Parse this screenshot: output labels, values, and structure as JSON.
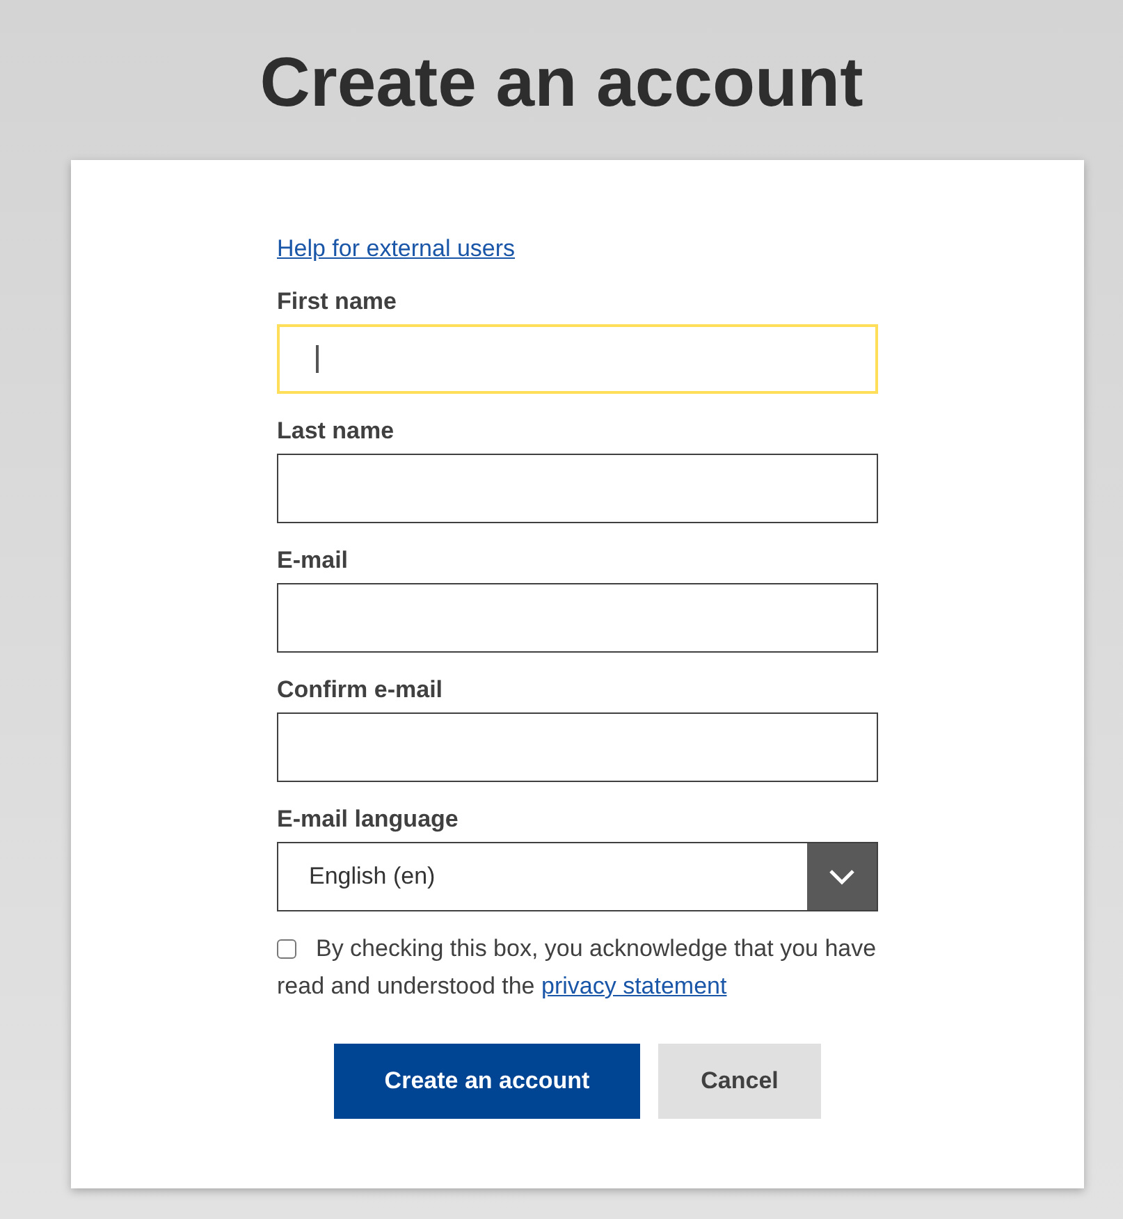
{
  "title": "Create an account",
  "help_link": "Help for external users",
  "fields": [
    {
      "kind": "text",
      "label": "First name",
      "focused": true
    },
    {
      "kind": "text",
      "label": "Last name",
      "focused": false
    },
    {
      "kind": "text",
      "label": "E-mail",
      "focused": false
    },
    {
      "kind": "text",
      "label": "Confirm e-mail",
      "focused": false
    },
    {
      "kind": "select",
      "label": "E-mail language",
      "value": "English (en)",
      "focused": false
    }
  ],
  "consent": {
    "checked": false,
    "text": "By checking this box, you acknowledge that you have read and understood the",
    "link": "privacy statement"
  },
  "buttons": [
    {
      "kind": "primary",
      "label": "Create an account"
    },
    {
      "kind": "secondary",
      "label": "Cancel"
    }
  ]
}
